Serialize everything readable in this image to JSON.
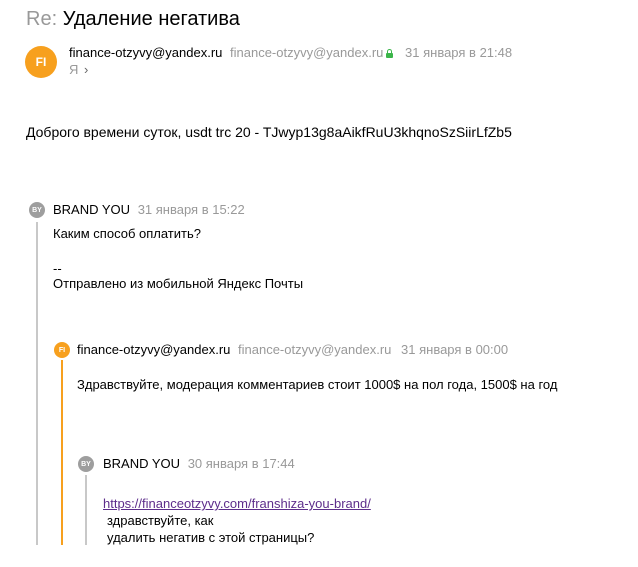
{
  "subject": {
    "prefix": "Re:",
    "title": "Удаление негатива"
  },
  "message": {
    "avatar_initials": "FI",
    "from_email": "finance-otzyvy@yandex.ru",
    "from_address": "finance-otzyvy@yandex.ru",
    "date": "31 января в 21:48",
    "to": "Я",
    "to_chevron": "›",
    "body": "Доброго времени суток, usdt trc 20 - TJwyp13g8aAikfRuU3khqnoSzSiirLfZb5"
  },
  "quote1": {
    "avatar_initials": "BY",
    "from_name": "BRAND YOU",
    "date": "31 января в 15:22",
    "line1": "Каким способ оплатить?",
    "sig_sep": "--",
    "sig": "Отправлено из мобильной Яндекс Почты"
  },
  "quote2": {
    "avatar_initials": "FI",
    "from_email": "finance-otzyvy@yandex.ru",
    "from_address": "finance-otzyvy@yandex.ru",
    "date": "31 января в 00:00",
    "body": "Здравствуйте, модерация комментариев стоит 1000$ на пол года, 1500$ на год"
  },
  "quote3": {
    "avatar_initials": "BY",
    "from_name": "BRAND YOU",
    "date": "30 января в 17:44",
    "link": "https://financeotzyvy.com/franshiza-you-brand/",
    "line1": "здравствуйте, как",
    "line2": "удалить негатив с этой страницы?"
  },
  "colors": {
    "avatar_orange": "#f7a01e",
    "avatar_gray": "#9e9e9e",
    "quote_bar_gray": "#c8c8c8",
    "quote_bar_orange": "#f7a01e",
    "link": "#5d2d8b",
    "lock_green": "#3bb54a"
  }
}
